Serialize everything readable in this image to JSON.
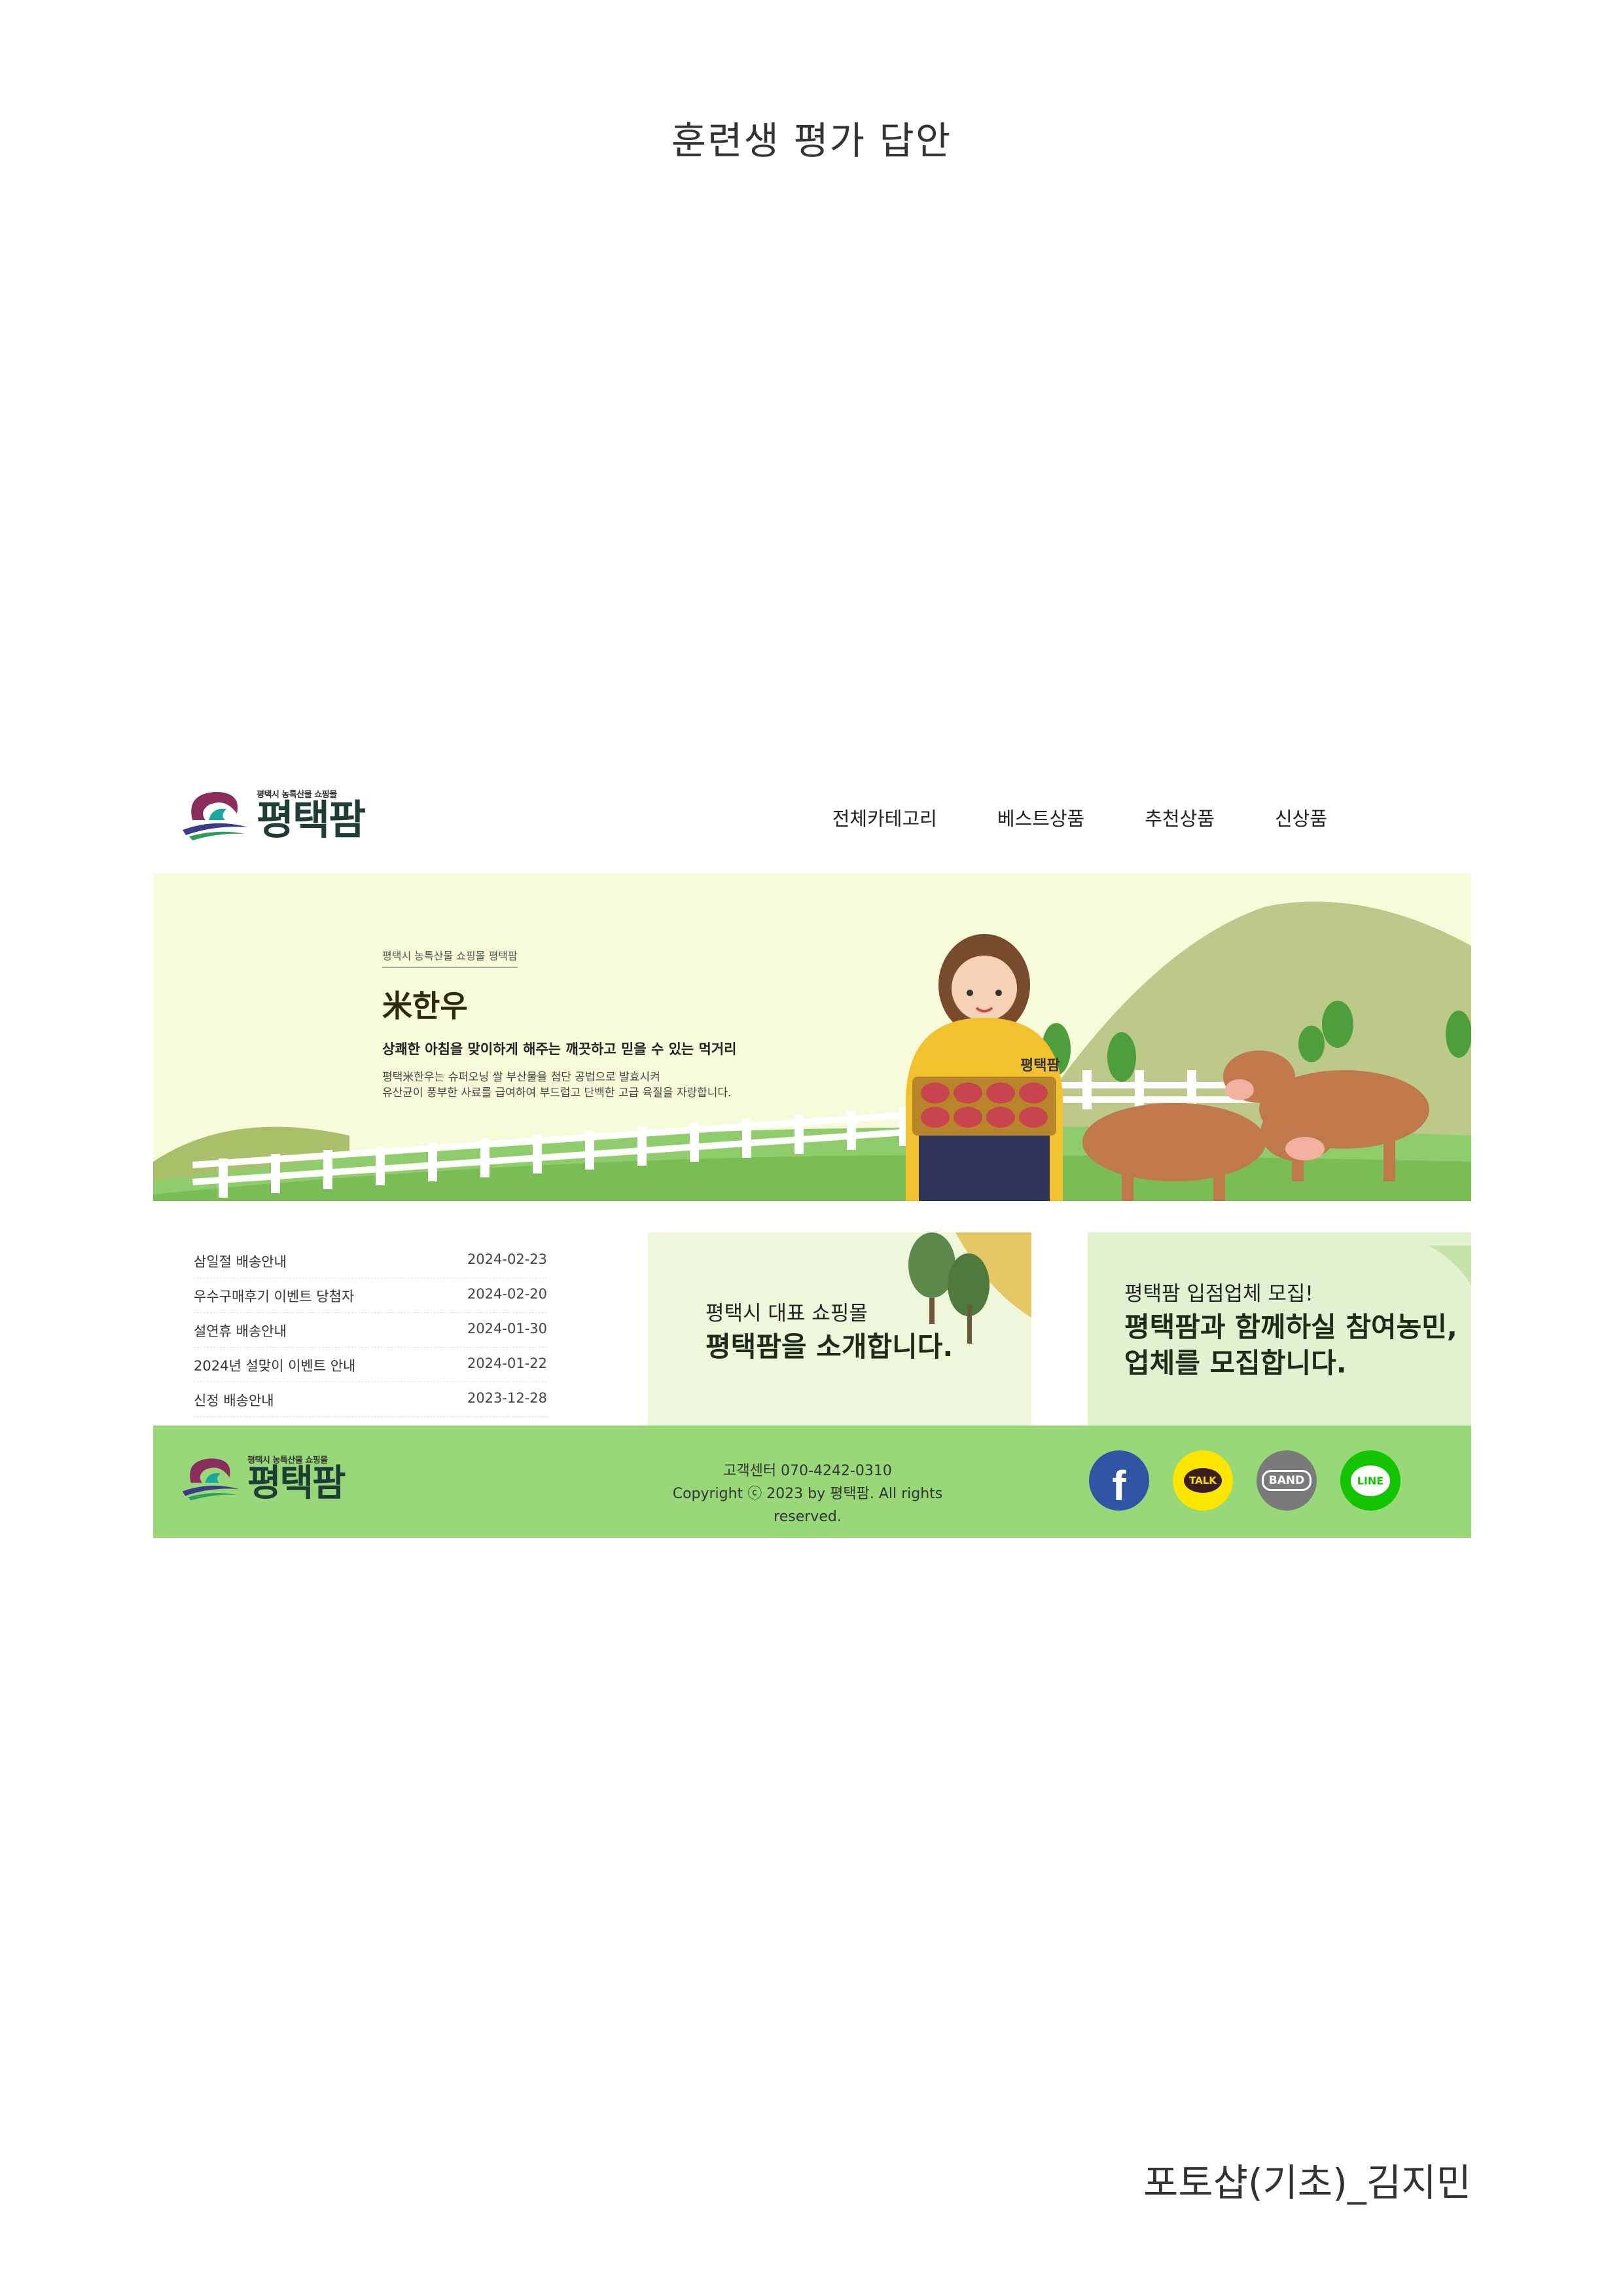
{
  "doc": {
    "title": "훈련생 평가 답안",
    "author": "포토샵(기초)_김지민"
  },
  "site": {
    "logo_sub": "평택시 농특산물 쇼핑몰",
    "logo_name": "평택팜",
    "nav": [
      "전체카테고리",
      "베스트상품",
      "추천상품",
      "신상품"
    ]
  },
  "hero": {
    "eyebrow": "평택시 농특산물 쇼핑몰 평택팜",
    "title": "米한우",
    "subtitle": "상쾌한 아침을 맞이하게 해주는 깨끗하고 믿을 수 있는 먹거리",
    "desc": "평택米한우는 슈퍼오닝 쌀 부산물을 첨단 공법으로 발효시켜\n유산균이 풍부한 사료를 급여하여 부드럽고 단백한 고급 육질을 자랑합니다.",
    "shirt_logo": "평택팜"
  },
  "notices": [
    {
      "title": "삼일절 배송안내",
      "date": "2024-02-23"
    },
    {
      "title": "우수구매후기 이벤트 당첨자",
      "date": "2024-02-20"
    },
    {
      "title": "설연휴 배송안내",
      "date": "2024-01-30"
    },
    {
      "title": "2024년 설맞이 이벤트 안내",
      "date": "2024-01-22"
    },
    {
      "title": "신정 배송안내",
      "date": "2023-12-28"
    }
  ],
  "promo1": {
    "small": "평택시 대표 쇼핑몰",
    "big": "평택팜을 소개합니다."
  },
  "promo2": {
    "small": "평택팜 입점업체 모집!",
    "big": "평택팜과 함께하실 참여농민,\n업체를 모집합니다."
  },
  "footer": {
    "contact": "고객센터 070-4242-0310",
    "copyright": "Copyright ⓒ 2023 by 평택팜. All rights reserved."
  },
  "social": {
    "facebook": "f",
    "kakao": "TALK",
    "band": "BAND",
    "line": "LINE"
  },
  "colors": {
    "hero_bg": "#f8fbd9",
    "footer_bg": "#99d878",
    "promo1_bg": "#eef7d9",
    "promo2_bg": "#e0f2cf"
  }
}
